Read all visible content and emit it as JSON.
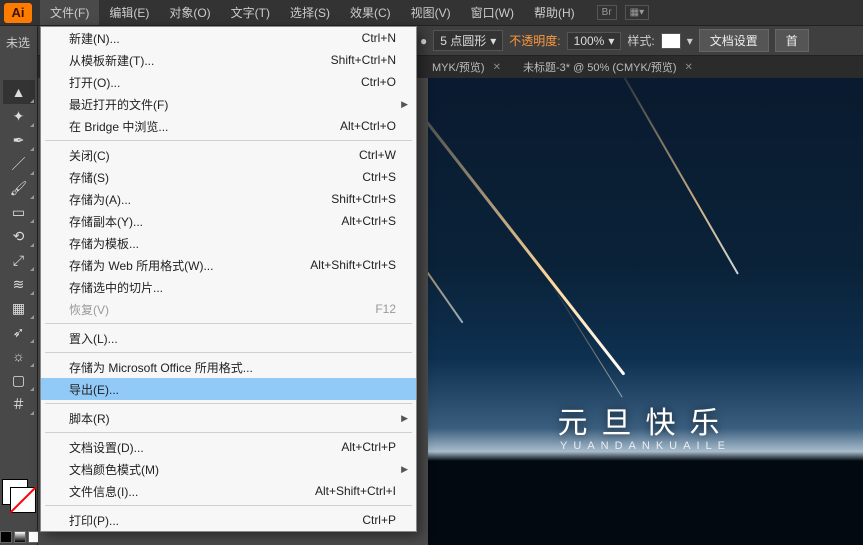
{
  "app_icon": "Ai",
  "menubar": [
    "文件(F)",
    "编辑(E)",
    "对象(O)",
    "文字(T)",
    "选择(S)",
    "效果(C)",
    "视图(V)",
    "窗口(W)",
    "帮助(H)"
  ],
  "menubar_extra": [
    "Br"
  ],
  "unselected_label": "未选",
  "options": {
    "stroke_value": "5 点圆形",
    "opacity_label": "不透明度:",
    "opacity_value": "100%",
    "style_label": "样式:",
    "doc_setup": "文档设置",
    "first": "首"
  },
  "tabs": [
    {
      "label": "MYK/预览)"
    },
    {
      "label": "未标题-3* @ 50% (CMYK/预览)"
    }
  ],
  "dropdown": [
    {
      "label": "新建(N)...",
      "shortcut": "Ctrl+N"
    },
    {
      "label": "从模板新建(T)...",
      "shortcut": "Shift+Ctrl+N"
    },
    {
      "label": "打开(O)...",
      "shortcut": "Ctrl+O"
    },
    {
      "label": "最近打开的文件(F)",
      "submenu": true
    },
    {
      "label": "在 Bridge 中浏览...",
      "shortcut": "Alt+Ctrl+O"
    },
    {
      "sep": true
    },
    {
      "label": "关闭(C)",
      "shortcut": "Ctrl+W"
    },
    {
      "label": "存储(S)",
      "shortcut": "Ctrl+S"
    },
    {
      "label": "存储为(A)...",
      "shortcut": "Shift+Ctrl+S"
    },
    {
      "label": "存储副本(Y)...",
      "shortcut": "Alt+Ctrl+S"
    },
    {
      "label": "存储为模板..."
    },
    {
      "label": "存储为 Web 所用格式(W)...",
      "shortcut": "Alt+Shift+Ctrl+S"
    },
    {
      "label": "存储选中的切片..."
    },
    {
      "label": "恢复(V)",
      "shortcut": "F12",
      "disabled": true
    },
    {
      "sep": true
    },
    {
      "label": "置入(L)..."
    },
    {
      "sep": true
    },
    {
      "label": "存储为 Microsoft Office 所用格式..."
    },
    {
      "label": "导出(E)...",
      "hover": true
    },
    {
      "sep": true
    },
    {
      "label": "脚本(R)",
      "submenu": true
    },
    {
      "sep": true
    },
    {
      "label": "文档设置(D)...",
      "shortcut": "Alt+Ctrl+P"
    },
    {
      "label": "文档颜色模式(M)",
      "submenu": true
    },
    {
      "label": "文件信息(I)...",
      "shortcut": "Alt+Shift+Ctrl+I"
    },
    {
      "sep": true
    },
    {
      "label": "打印(P)...",
      "shortcut": "Ctrl+P"
    }
  ],
  "artwork": {
    "title": "元旦快乐",
    "subtitle": "YUANDANKUAILE"
  },
  "tools": [
    "selection",
    "magic-wand",
    "pen",
    "brush",
    "paintbrush",
    "eraser",
    "rotate",
    "scale",
    "width",
    "mesh",
    "eyedropper",
    "symbol",
    "artboard",
    "slice"
  ]
}
